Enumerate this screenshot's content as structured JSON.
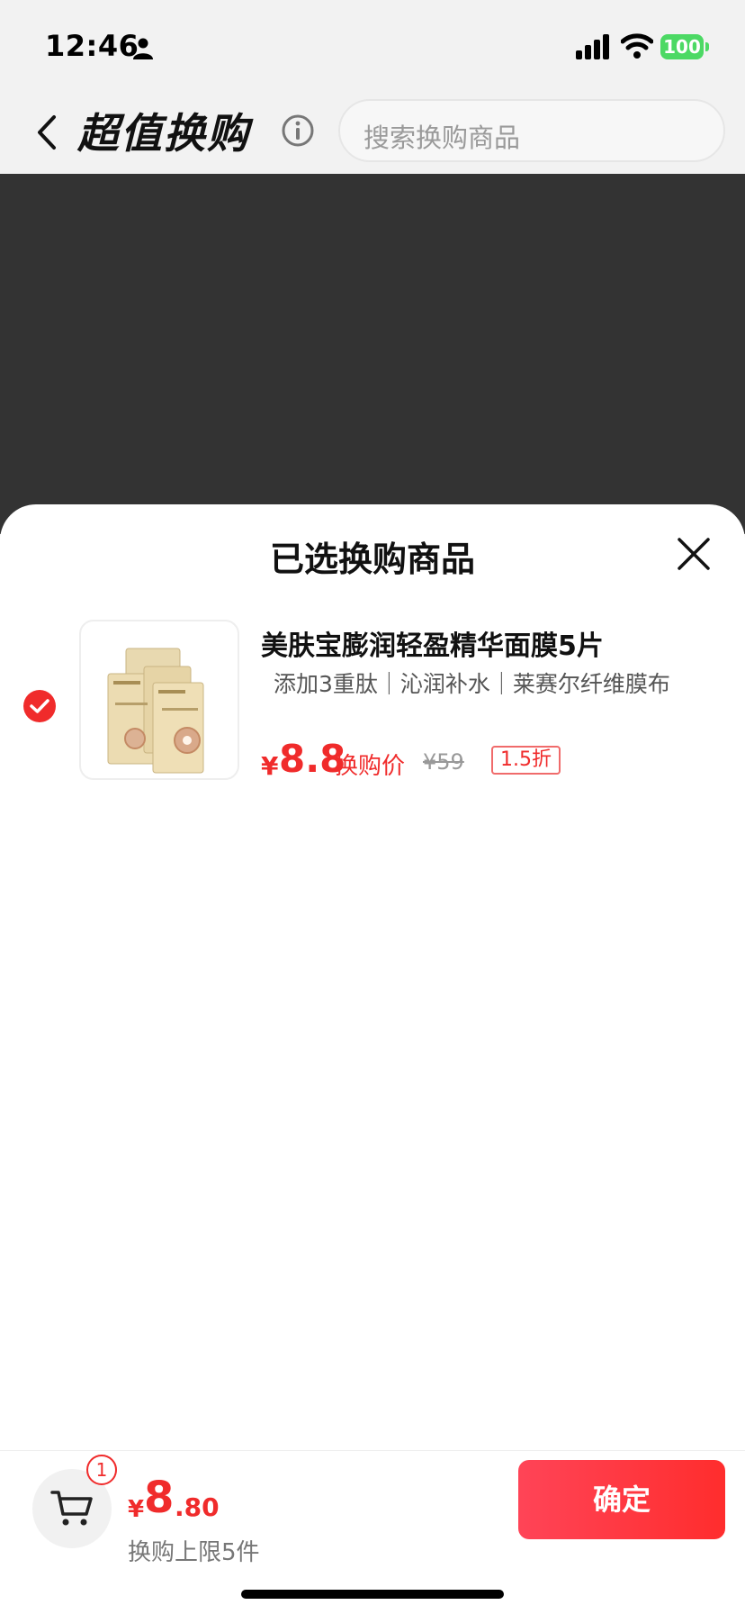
{
  "status_bar": {
    "time": "12:46",
    "battery": "100"
  },
  "nav": {
    "title": "超值换购",
    "search_placeholder": "搜索换购商品"
  },
  "sheet": {
    "title": "已选换购商品",
    "items": [
      {
        "name": "美肤宝膨润轻盈精华面膜5片",
        "tags": "添加3重肽｜沁润补水｜莱赛尔纤维膜布",
        "currency": "¥",
        "price": "8.8",
        "price_label": "换购价",
        "original_price": "¥59",
        "discount": "1.5折",
        "selected": true
      }
    ]
  },
  "bottom": {
    "cart_count": "1",
    "currency": "¥",
    "total_int": "8",
    "total_dec": ".80",
    "limit_text": "换购上限5件",
    "confirm_label": "确定"
  },
  "colors": {
    "accent": "#f02b2b",
    "overlay": "#333333",
    "battery": "#4cd964"
  }
}
